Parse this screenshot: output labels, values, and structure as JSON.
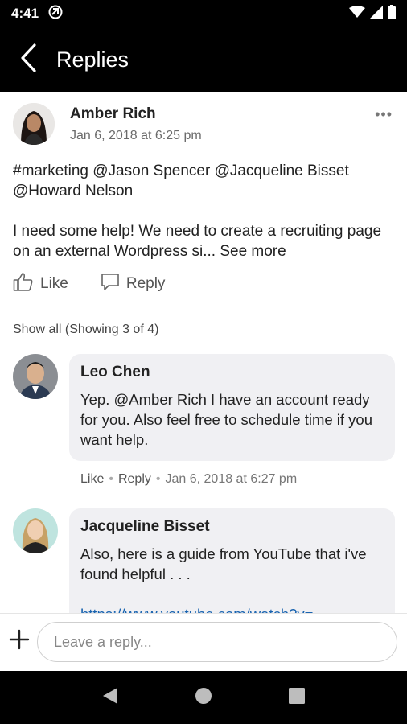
{
  "status_bar": {
    "time": "4:41",
    "icons": [
      "notification-icon",
      "wifi-icon",
      "cellular-icon",
      "battery-icon"
    ]
  },
  "header": {
    "title": "Replies",
    "back_icon": "back-arrow-icon"
  },
  "post": {
    "author": "Amber Rich",
    "date": "Jan 6, 2018 at 6:25 pm",
    "mentions": "#marketing @Jason Spencer @Jacqueline Bisset @Howard Nelson",
    "body": "I need some help! We need to create a recruiting page on an external Wordpress si...",
    "see_more": "See more",
    "like_label": "Like",
    "reply_label": "Reply"
  },
  "replies_header": {
    "show_all": "Show all (Showing 3 of 4)"
  },
  "replies": [
    {
      "author": "Leo Chen",
      "text": "Yep. @Amber Rich I have an account ready for you.  Also feel free to schedule time if you want help.",
      "like_label": "Like",
      "reply_label": "Reply",
      "date": "Jan 6, 2018 at 6:27 pm"
    },
    {
      "author": "Jacqueline Bisset",
      "text": "Also, here is a guide from YouTube that i've found helpful . . .",
      "link": "https://www.youtube.com/watch?v="
    }
  ],
  "composer": {
    "placeholder": "Leave a reply...",
    "value": ""
  },
  "nav": {
    "back": "nav-back-icon",
    "home": "nav-home-icon",
    "recents": "nav-recents-icon"
  }
}
